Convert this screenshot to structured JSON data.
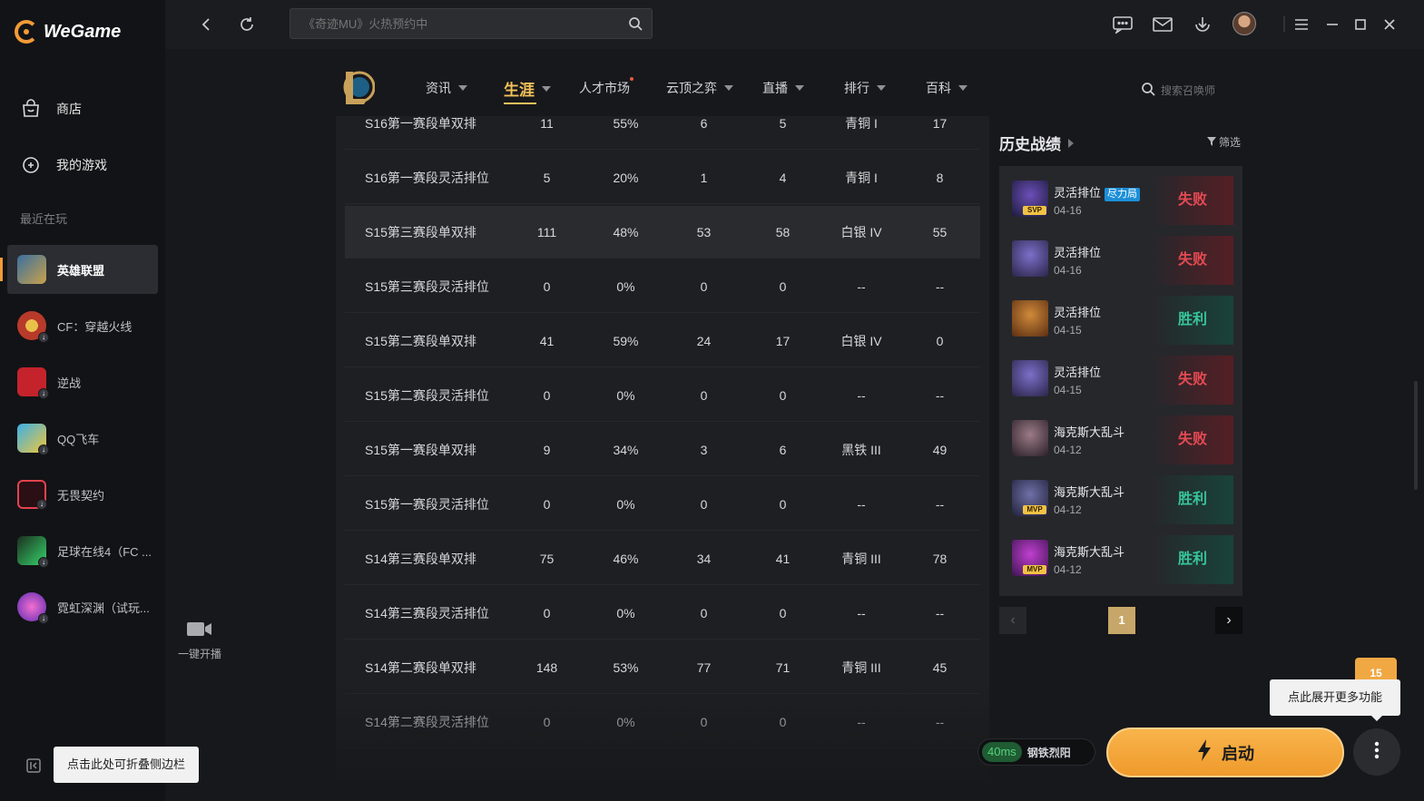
{
  "app": {
    "name": "WeGame"
  },
  "sidebar": {
    "items": [
      {
        "label": "商店",
        "icon": "shop-icon"
      },
      {
        "label": "我的游戏",
        "icon": "gamepad-icon"
      }
    ],
    "recent_label": "最近在玩",
    "games": [
      {
        "label": "英雄联盟",
        "icon": "lol-icon",
        "active": true
      },
      {
        "label": "CF：穿越火线",
        "icon": "cf-icon"
      },
      {
        "label": "逆战",
        "icon": "nizhan-icon"
      },
      {
        "label": "QQ飞车",
        "icon": "qq-speed-icon"
      },
      {
        "label": "无畏契约",
        "icon": "valorant-icon"
      },
      {
        "label": "足球在线4（FC ...",
        "icon": "fc-online-icon"
      },
      {
        "label": "霓虹深渊（试玩...",
        "icon": "neon-abyss-icon"
      }
    ],
    "collapse_tip": "点击此处可折叠侧边栏"
  },
  "topbar": {
    "search_placeholder": "《奇迹MU》火热预约中"
  },
  "game_nav": {
    "tabs": [
      {
        "label": "资讯"
      },
      {
        "label": "生涯",
        "active": true
      },
      {
        "label": "人才市场"
      },
      {
        "label": "云顶之弈"
      },
      {
        "label": "直播"
      },
      {
        "label": "排行"
      },
      {
        "label": "百科"
      }
    ],
    "summoner_search_placeholder": "搜索召唤师"
  },
  "stats_table": {
    "rows": [
      [
        "S16第一赛段单双排",
        "11",
        "55%",
        "6",
        "5",
        "青铜 I",
        "17"
      ],
      [
        "S16第一赛段灵活排位",
        "5",
        "20%",
        "1",
        "4",
        "青铜 I",
        "8"
      ],
      [
        "S15第三赛段单双排",
        "111",
        "48%",
        "53",
        "58",
        "白银 IV",
        "55"
      ],
      [
        "S15第三赛段灵活排位",
        "0",
        "0%",
        "0",
        "0",
        "--",
        "--"
      ],
      [
        "S15第二赛段单双排",
        "41",
        "59%",
        "24",
        "17",
        "白银 IV",
        "0"
      ],
      [
        "S15第二赛段灵活排位",
        "0",
        "0%",
        "0",
        "0",
        "--",
        "--"
      ],
      [
        "S15第一赛段单双排",
        "9",
        "34%",
        "3",
        "6",
        "黑铁 III",
        "49"
      ],
      [
        "S15第一赛段灵活排位",
        "0",
        "0%",
        "0",
        "0",
        "--",
        "--"
      ],
      [
        "S14第三赛段单双排",
        "75",
        "46%",
        "34",
        "41",
        "青铜 III",
        "78"
      ],
      [
        "S14第三赛段灵活排位",
        "0",
        "0%",
        "0",
        "0",
        "--",
        "--"
      ],
      [
        "S14第二赛段单双排",
        "148",
        "53%",
        "77",
        "71",
        "青铜 III",
        "45"
      ],
      [
        "S14第二赛段灵活排位",
        "0",
        "0%",
        "0",
        "0",
        "--",
        "--"
      ]
    ]
  },
  "history": {
    "title": "历史战绩",
    "filter_label": "筛选",
    "matches": [
      {
        "mode": "灵活排位",
        "tag": "尽力局",
        "date": "04-16",
        "result": "失败",
        "win": false,
        "badge": "SVP",
        "champ_colors": [
          "#6b4fb8",
          "#1c1a3a"
        ]
      },
      {
        "mode": "灵活排位",
        "date": "04-16",
        "result": "失败",
        "win": false,
        "champ_colors": [
          "#7b6fc9",
          "#2b2448"
        ]
      },
      {
        "mode": "灵活排位",
        "date": "04-15",
        "result": "胜利",
        "win": true,
        "champ_colors": [
          "#d08a3a",
          "#5b2e12"
        ]
      },
      {
        "mode": "灵活排位",
        "date": "04-15",
        "result": "失败",
        "win": false,
        "champ_colors": [
          "#7b6fc9",
          "#2b2448"
        ]
      },
      {
        "mode": "海克斯大乱斗",
        "date": "04-12",
        "result": "失败",
        "win": false,
        "champ_colors": [
          "#9b7b86",
          "#2a1f28"
        ]
      },
      {
        "mode": "海克斯大乱斗",
        "date": "04-12",
        "result": "胜利",
        "win": true,
        "badge": "MVP",
        "champ_colors": [
          "#6f70a8",
          "#202038"
        ]
      },
      {
        "mode": "海克斯大乱斗",
        "date": "04-12",
        "result": "胜利",
        "win": true,
        "badge": "MVP",
        "champ_colors": [
          "#c03fd0",
          "#3d1450"
        ]
      }
    ],
    "pagination": {
      "current": "1"
    }
  },
  "broadcast": {
    "label": "一键开播"
  },
  "launcher": {
    "ping": "40ms",
    "server": "钢铁烈阳",
    "start_label": "启动",
    "more_tip": "点此展开更多功能",
    "promo": "15"
  },
  "colors": {
    "accent": "#f29a38",
    "gold": "#f2c15b",
    "win": "#37c59b",
    "lose": "#e44a53"
  }
}
